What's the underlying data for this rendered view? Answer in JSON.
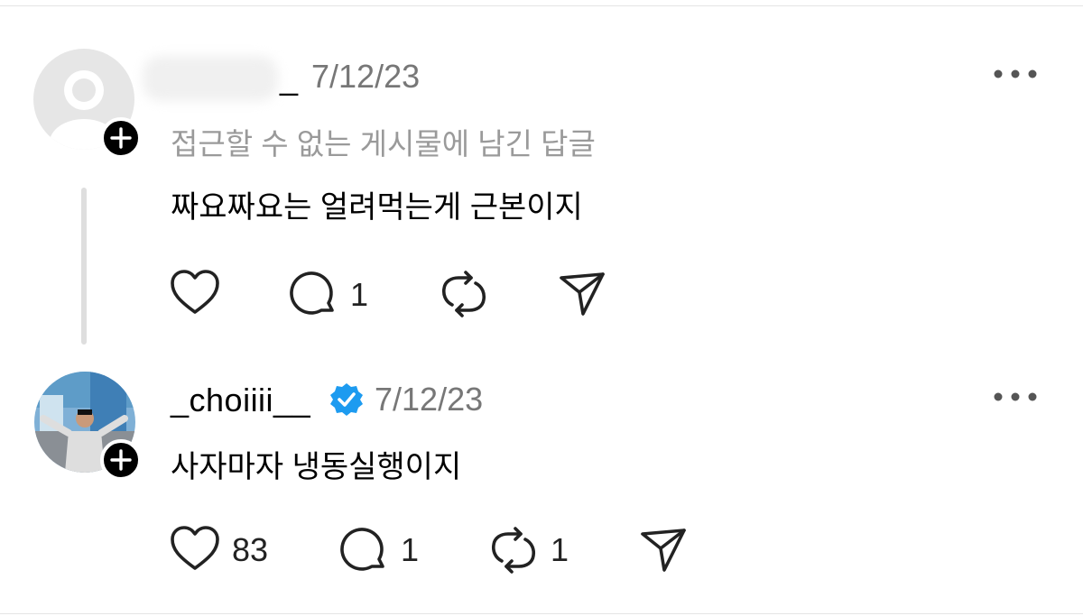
{
  "posts": [
    {
      "username": "_",
      "date": "7/12/23",
      "context": "접근할 수 없는 게시물에 남긴 답글",
      "text": "짜요짜요는 얼려먹는게 근본이지",
      "likes": "",
      "replies": "1",
      "reposts": ""
    },
    {
      "username": "_choiiii__",
      "date": "7/12/23",
      "text": "사자마자 냉동실행이지",
      "likes": "83",
      "replies": "1",
      "reposts": "1"
    }
  ],
  "colors": {
    "verified": "#1d9bf0",
    "muted": "#9a9a9a",
    "divider": "#e4e4e4"
  }
}
